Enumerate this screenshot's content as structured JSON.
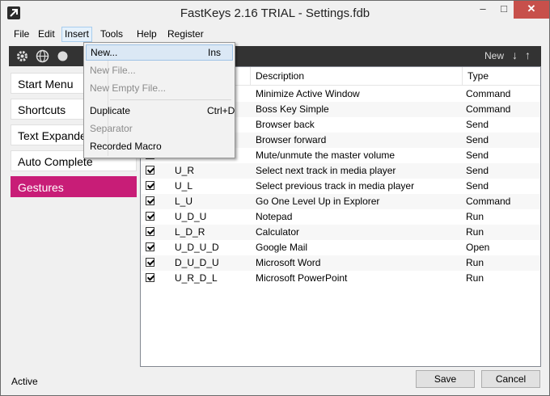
{
  "window": {
    "title": "FastKeys 2.16 TRIAL - Settings.fdb",
    "controls": {
      "minimize": "–",
      "maximize": "□",
      "close": "✕"
    }
  },
  "menubar": [
    "File",
    "Edit",
    "Insert",
    "Tools",
    "Help",
    "Register"
  ],
  "toolbar": {
    "new_label": "New",
    "icons": [
      "gear-icon",
      "globe-icon",
      "partial-icon"
    ]
  },
  "sidebar": {
    "items": [
      "Start Menu",
      "Shortcuts",
      "Text Expander",
      "Auto Complete",
      "Gestures"
    ],
    "selected": "Gestures",
    "selected_color": "#c81d77"
  },
  "table": {
    "headers": [
      "Description",
      "Type"
    ],
    "rows": [
      {
        "gesture": "",
        "description": "Minimize Active Window",
        "type": "Command"
      },
      {
        "gesture": "",
        "description": "Boss Key Simple",
        "type": "Command"
      },
      {
        "gesture": "",
        "description": "Browser back",
        "type": "Send"
      },
      {
        "gesture": "",
        "description": "Browser forward",
        "type": "Send"
      },
      {
        "gesture": "",
        "description": "Mute/unmute the master volume",
        "type": "Send"
      },
      {
        "gesture": "U_R",
        "description": "Select next track in media player",
        "type": "Send"
      },
      {
        "gesture": "U_L",
        "description": "Select previous track in media player",
        "type": "Send"
      },
      {
        "gesture": "L_U",
        "description": "Go One Level Up in Explorer",
        "type": "Command"
      },
      {
        "gesture": "U_D_U",
        "description": "Notepad",
        "type": "Run"
      },
      {
        "gesture": "L_D_R",
        "description": "Calculator",
        "type": "Run"
      },
      {
        "gesture": "U_D_U_D",
        "description": "Google Mail",
        "type": "Open"
      },
      {
        "gesture": "D_U_D_U",
        "description": "Microsoft Word",
        "type": "Run"
      },
      {
        "gesture": "U_R_D_L",
        "description": "Microsoft PowerPoint",
        "type": "Run"
      }
    ]
  },
  "dropdown": {
    "items": [
      {
        "label": "New...",
        "shortcut": "Ins",
        "disabled": false,
        "hover": true
      },
      {
        "label": "New File...",
        "shortcut": "",
        "disabled": true
      },
      {
        "label": "New Empty File...",
        "shortcut": "",
        "disabled": true
      },
      {
        "label": "Duplicate",
        "shortcut": "Ctrl+D",
        "disabled": false
      },
      {
        "label": "Separator",
        "shortcut": "",
        "disabled": true
      },
      {
        "label": "Recorded Macro",
        "shortcut": "",
        "disabled": false
      }
    ]
  },
  "status": "Active",
  "buttons": {
    "save": "Save",
    "cancel": "Cancel"
  }
}
